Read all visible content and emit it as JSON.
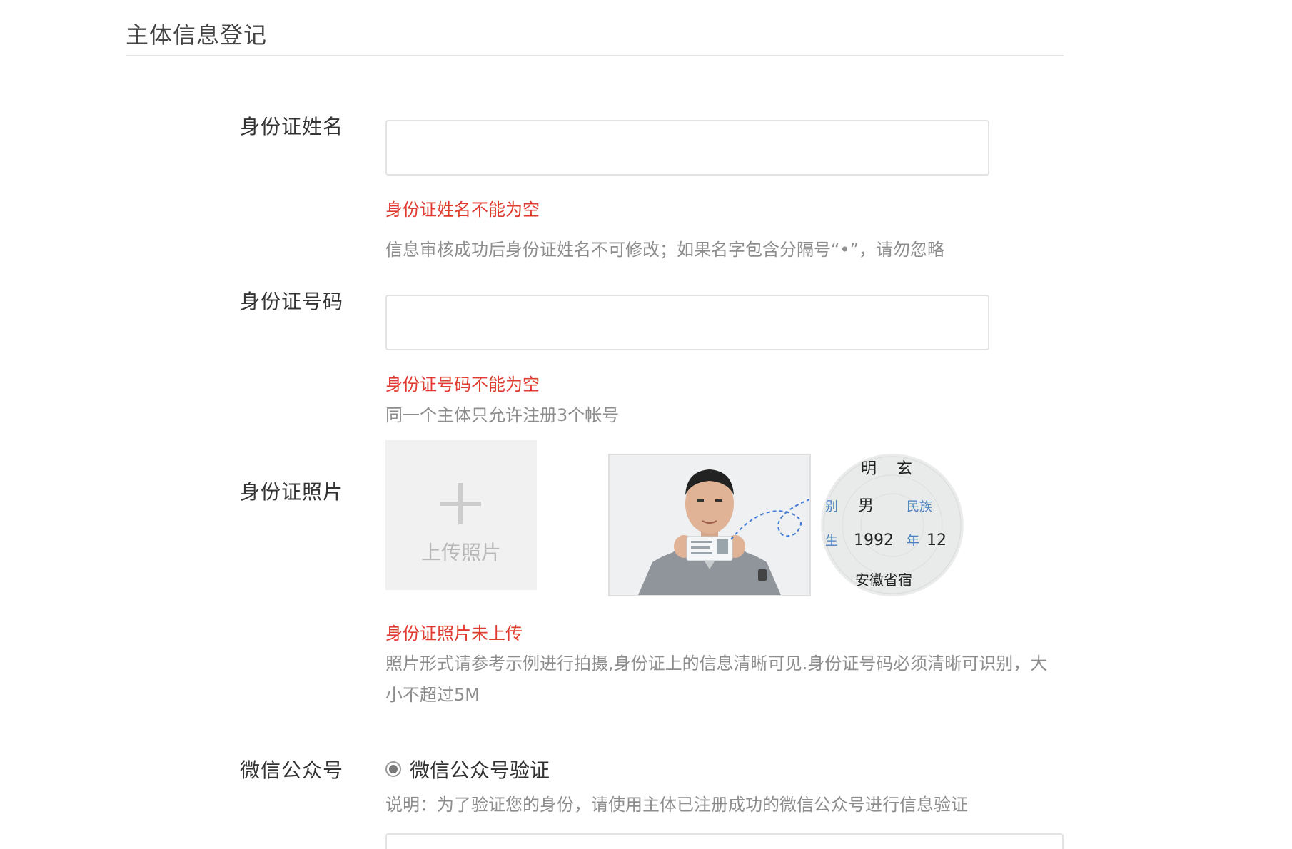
{
  "section": {
    "title": "主体信息登记"
  },
  "fields": {
    "id_name": {
      "label": "身份证姓名",
      "value": "",
      "error": "身份证姓名不能为空",
      "hint": "信息审核成功后身份证姓名不可修改；如果名字包含分隔号“•”，请勿忽略"
    },
    "id_number": {
      "label": "身份证号码",
      "value": "",
      "error": "身份证号码不能为空",
      "hint": "同一个主体只允许注册3个帐号"
    },
    "id_photo": {
      "label": "身份证照片",
      "upload_label": "上传照片",
      "error": "身份证照片未上传",
      "hint_line1": "照片形式请参考示例进行拍摄,身份证上的信息清晰可见.身份证号码必须清晰可识别，大",
      "hint_line2": "小不超过5M",
      "example_card": {
        "row1_a": "明",
        "row1_b": "玄",
        "row2_label_a": "别",
        "row2_value": "男",
        "row2_label_b": "民族",
        "row3_label_a": "生",
        "row3_year": "1992",
        "row3_label_b": "年",
        "row3_month": "12",
        "row4": "安徽省宿"
      }
    },
    "wechat": {
      "label": "微信公众号",
      "option_label": "微信公众号验证",
      "option_selected": true,
      "hint": "说明：为了验证您的身份，请使用主体已注册成功的微信公众号进行信息验证"
    }
  },
  "colors": {
    "error": "#e03b30",
    "hint": "#8d8d8d",
    "divider": "#e2e2e2",
    "input_border": "#e3e3e3",
    "upload_bg": "#f1f1f1"
  }
}
